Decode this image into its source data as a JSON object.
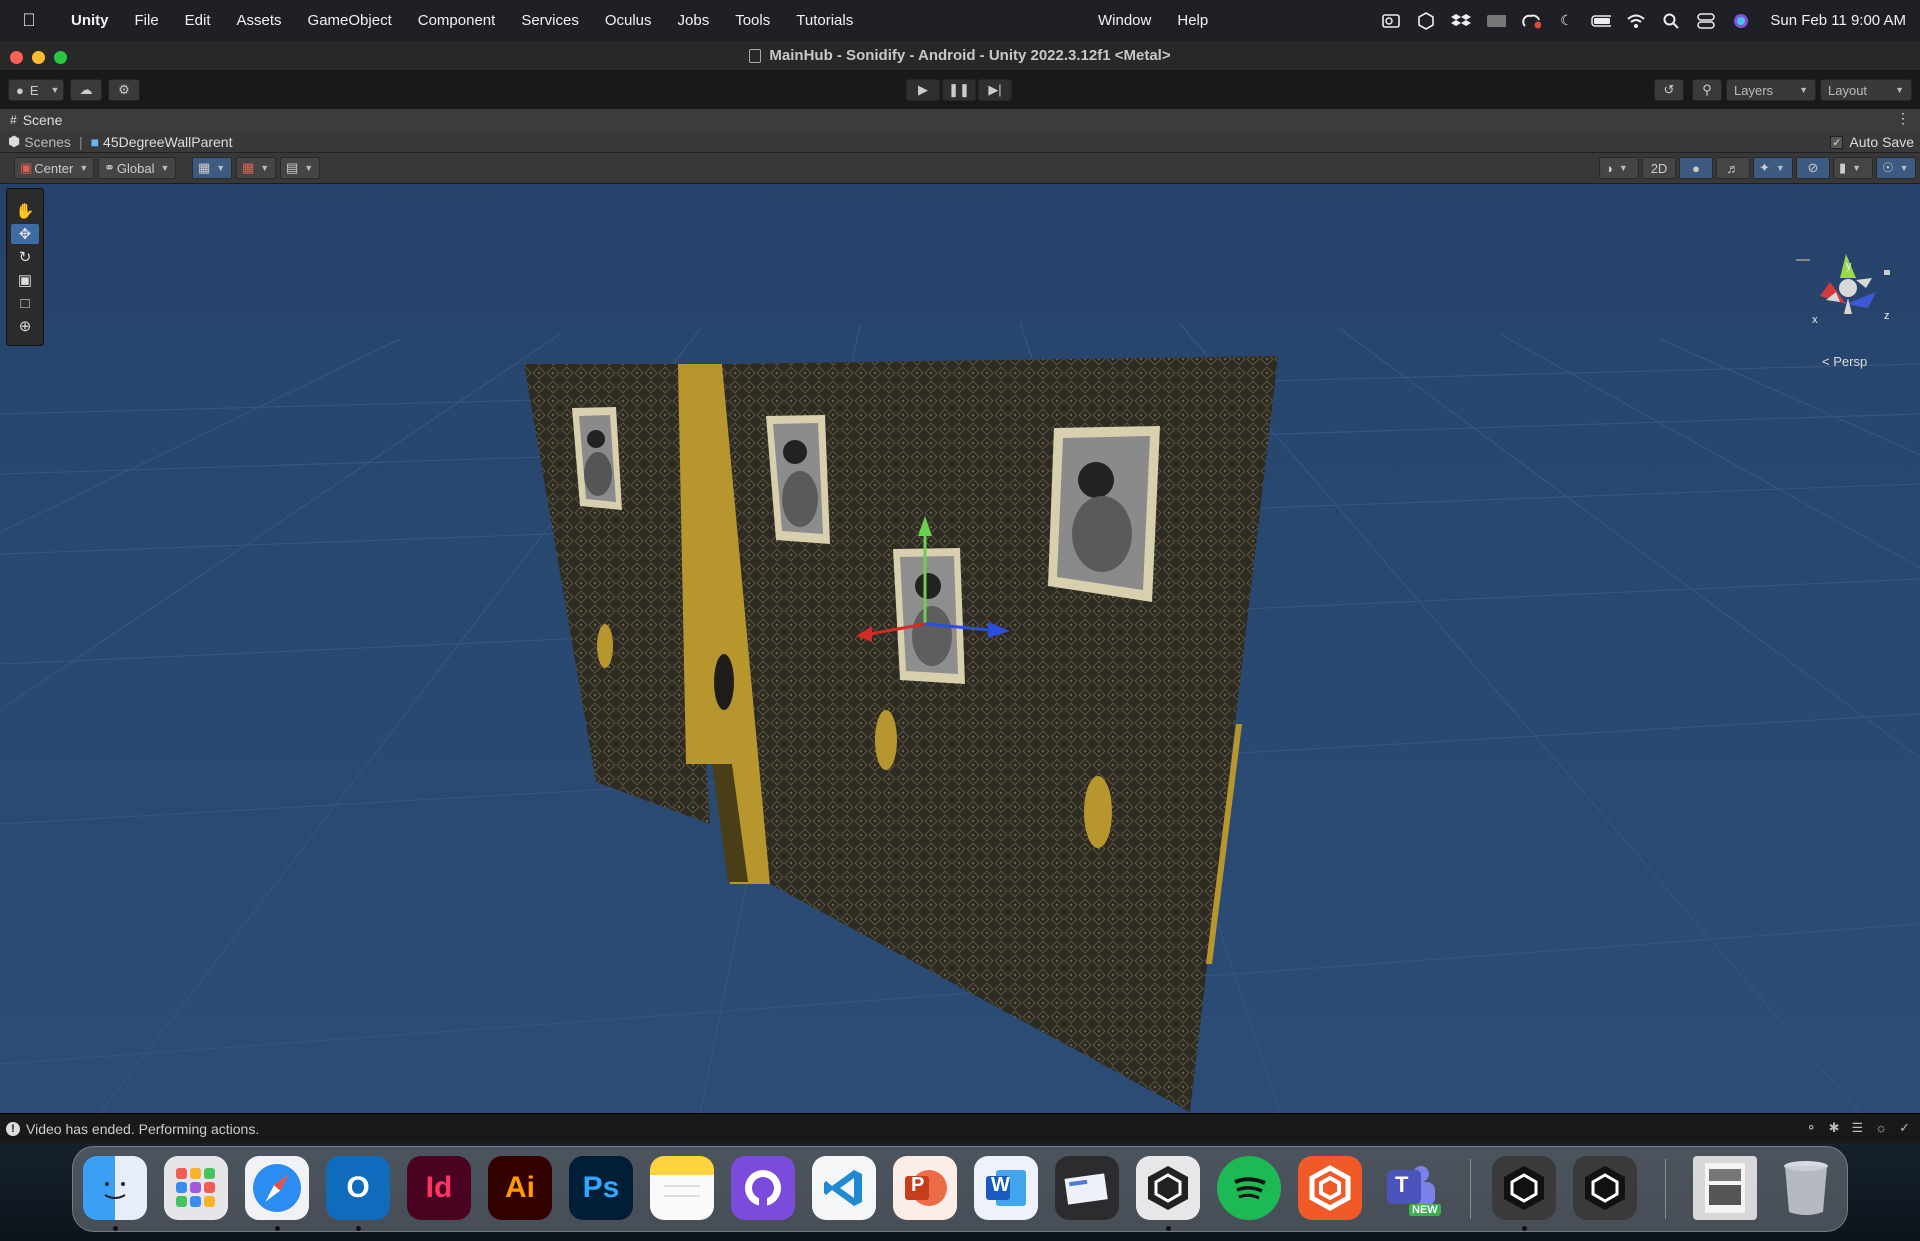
{
  "menubar": {
    "app_name": "Unity",
    "menus": [
      "File",
      "Edit",
      "Assets",
      "GameObject",
      "Component",
      "Services",
      "Oculus",
      "Jobs",
      "Tools",
      "Tutorials"
    ],
    "window": "Window",
    "help": "Help",
    "clock": "Sun Feb 11  9:00 AM"
  },
  "window": {
    "title": "MainHub - Sonidify - Android - Unity 2022.3.12f1 <Metal>"
  },
  "toolbar": {
    "account_label": "E",
    "layers_label": "Layers",
    "layout_label": "Layout"
  },
  "scene": {
    "tab_label": "Scene",
    "breadcrumb_root": "Scenes",
    "breadcrumb_object": "45DegreeWallParent",
    "auto_save_label": "Auto Save",
    "auto_save_checked": true,
    "pivot_label": "Center",
    "space_label": "Global",
    "mode_2d_label": "2D",
    "persp_label": "Persp",
    "axis_x": "x",
    "axis_y": "y",
    "axis_z": "z"
  },
  "status": {
    "message": "Video has ended. Performing actions."
  },
  "dock": {
    "apps": [
      "finder",
      "launchpad",
      "safari",
      "outlook",
      "indesign",
      "illustrator",
      "photoshop",
      "notes",
      "github-desktop",
      "vscode",
      "powerpoint",
      "word",
      "mail-app",
      "unity-hub",
      "spotify",
      "app-icon",
      "teams",
      "unity",
      "unity",
      "downloads",
      "trash"
    ],
    "indesign_label": "Id",
    "illustrator_label": "Ai",
    "photoshop_label": "Ps",
    "powerpoint_label": "P",
    "word_label": "W",
    "outlook_label": "O",
    "teams_label": "T",
    "teams_badge": "NEW"
  },
  "colors": {
    "accent": "#3e6aa5",
    "viewport_sky": "#28466e",
    "wall": "#2f2c22",
    "gold": "#b8962e"
  }
}
